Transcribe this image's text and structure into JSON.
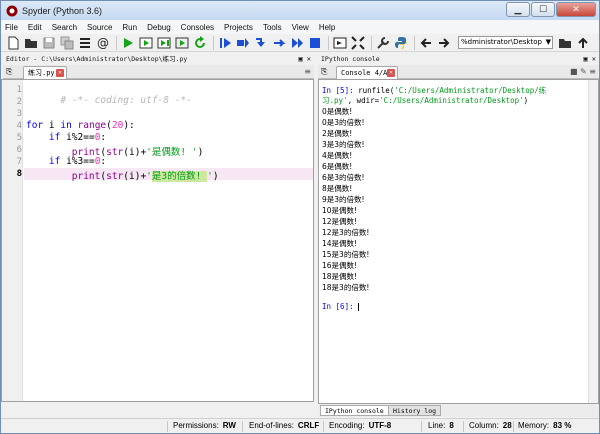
{
  "window": {
    "title": "Spyder (Python 3.6)"
  },
  "menu": [
    "File",
    "Edit",
    "Search",
    "Source",
    "Run",
    "Debug",
    "Consoles",
    "Projects",
    "Tools",
    "View",
    "Help"
  ],
  "toolbar": {
    "working_dir": "%dministrator\\Desktop"
  },
  "editor": {
    "pane_title": "Editor - C:\\Users\\Administrator\\Desktop\\练习.py",
    "tab_label": "练习.py",
    "current_line": 8,
    "line_numbers": [
      "1",
      "2",
      "3",
      "4",
      "5",
      "6",
      "7",
      "8"
    ],
    "lines": [
      "# -*- coding: utf-8 -*-",
      "",
      "",
      "for i in range(20):",
      "    if i%2==0:",
      "        print(str(i)+'是偶数! ')",
      "    if i%3==0:",
      "        print(str(i)+'是3的倍数! ')"
    ],
    "tokens": {
      "l1": "# -*- coding: utf-8 -*-",
      "for": "for",
      "in": "in",
      "range": "range",
      "n20": "20",
      "if": "if",
      "mod2": "i%2==",
      "zero": "0",
      "colon": ":",
      "mod3": "i%3==",
      "print": "print",
      "str": "str",
      "open_i": "(i)+",
      "s_even_q": "'",
      "s_even": "是偶数! ",
      "close": ")",
      "s_three": "是3的倍数! "
    }
  },
  "console": {
    "pane_title": "IPython console",
    "tab_label": "Console 4/A",
    "in5_prompt": "In [5]:",
    "in5_cmd": " runfile(",
    "in5_arg1": "'C:/Users/Administrator/Desktop/练",
    "in5_arg1b": "习.py'",
    "in5_wdir": ", wdir=",
    "in5_arg2": "'C:/Users/Administrator/Desktop'",
    "in5_close": ")",
    "output": [
      "0是偶数!",
      "0是3的倍数!",
      "2是偶数!",
      "3是3的倍数!",
      "4是偶数!",
      "6是偶数!",
      "6是3的倍数!",
      "8是偶数!",
      "9是3的倍数!",
      "10是偶数!",
      "12是偶数!",
      "12是3的倍数!",
      "14是偶数!",
      "15是3的倍数!",
      "16是偶数!",
      "18是偶数!",
      "18是3的倍数!"
    ],
    "in6_prompt": "In [6]:"
  },
  "bottom_tabs": [
    "IPython console",
    "History log"
  ],
  "status": {
    "permissions_label": "Permissions:",
    "permissions": "RW",
    "eol_label": "End-of-lines:",
    "eol": "CRLF",
    "encoding_label": "Encoding:",
    "encoding": "UTF-8",
    "line_label": "Line:",
    "line": "8",
    "column_label": "Column:",
    "column": "28",
    "memory_label": "Memory:",
    "memory": "83 %"
  }
}
